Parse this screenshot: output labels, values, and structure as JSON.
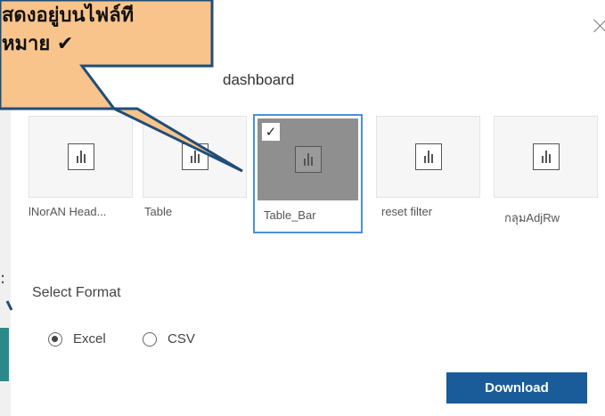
{
  "subtitle": "dashboard",
  "sheets": [
    {
      "label": "lNorAN Head...",
      "selected": false
    },
    {
      "label": "Table",
      "selected": false
    },
    {
      "label": "Table_Bar",
      "selected": true
    },
    {
      "label": "reset filter",
      "selected": false
    },
    {
      "label": "กลุมAdjRw",
      "selected": false
    }
  ],
  "check_mark": "✓",
  "format": {
    "label": "Select Format",
    "options": [
      {
        "label": "Excel",
        "selected": true
      },
      {
        "label": "CSV",
        "selected": false
      }
    ]
  },
  "download_label": "Download",
  "callout": {
    "line1": "สดงอยู่บนไฟล์ที",
    "line2": "หมาย ✔"
  },
  "left_strip_label": ":",
  "colors": {
    "accent": "#1a5c99",
    "selection": "#4a90d9",
    "callout_fill": "#f9c48b",
    "callout_stroke": "#1f4e79"
  }
}
